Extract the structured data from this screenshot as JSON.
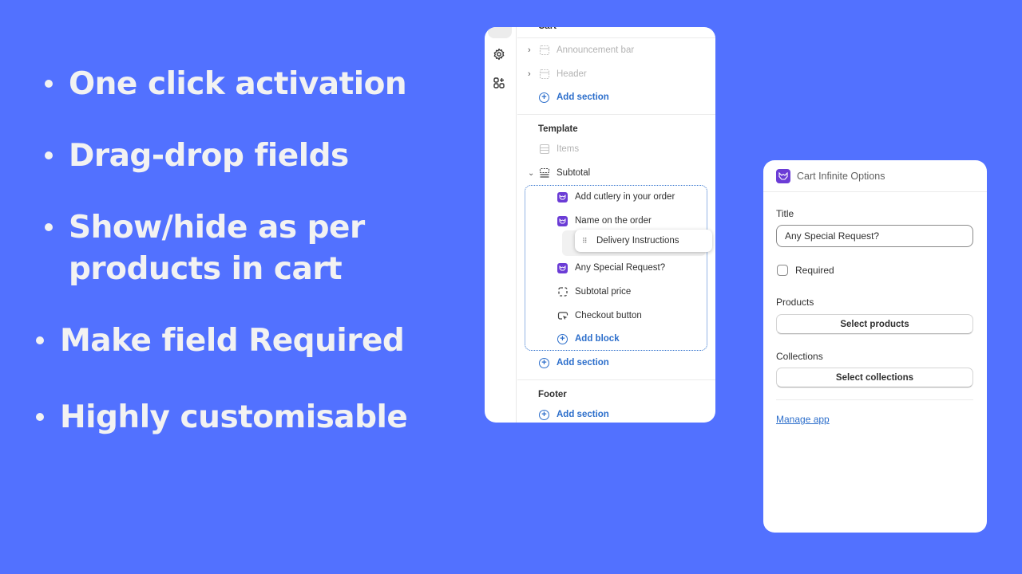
{
  "features": [
    {
      "lines": [
        "One click activation"
      ]
    },
    {
      "lines": [
        "Drag-drop fields"
      ]
    },
    {
      "lines": [
        "Show/hide as per",
        "products in cart"
      ]
    },
    {
      "lines": [
        "Make field Required"
      ]
    },
    {
      "lines": [
        "Highly customisable"
      ]
    }
  ],
  "editor": {
    "rail": [
      {
        "icon": "sections-icon",
        "active": true
      },
      {
        "icon": "gear-icon"
      },
      {
        "icon": "apps-add-icon"
      }
    ],
    "header_group": {
      "title": "Cart",
      "items": [
        {
          "label": "Announcement bar",
          "icon": "section-icon",
          "muted": true
        },
        {
          "label": "Header",
          "icon": "section-icon",
          "muted": true
        }
      ],
      "add_label": "Add section"
    },
    "template_group": {
      "title": "Template",
      "items_label": "Items",
      "subtotal_label": "Subtotal",
      "blocks": [
        {
          "label": "Add cutlery in your order",
          "icon": "app-block-icon"
        },
        {
          "label": "Name on the order",
          "icon": "app-block-icon"
        },
        {
          "label": "Any Special Request?",
          "icon": "app-block-icon"
        },
        {
          "label": "Subtotal price",
          "icon": "dashed-square-icon"
        },
        {
          "label": "Checkout button",
          "icon": "cursor-button-icon"
        }
      ],
      "dragging_label": "Delivery Instructions",
      "add_block_label": "Add block",
      "add_section_label": "Add section"
    },
    "footer_group": {
      "title": "Footer",
      "add_label": "Add section"
    }
  },
  "settings": {
    "app_name": "Cart Infinite Options",
    "title_label": "Title",
    "title_value": "Any Special Request?",
    "required_label": "Required",
    "required_checked": false,
    "products_label": "Products",
    "products_button": "Select products",
    "collections_label": "Collections",
    "collections_button": "Select collections",
    "manage_link": "Manage app"
  },
  "colors": {
    "background": "#5271ff",
    "accent_link": "#2c6ecb",
    "app_brand": "#6b3cd6"
  }
}
